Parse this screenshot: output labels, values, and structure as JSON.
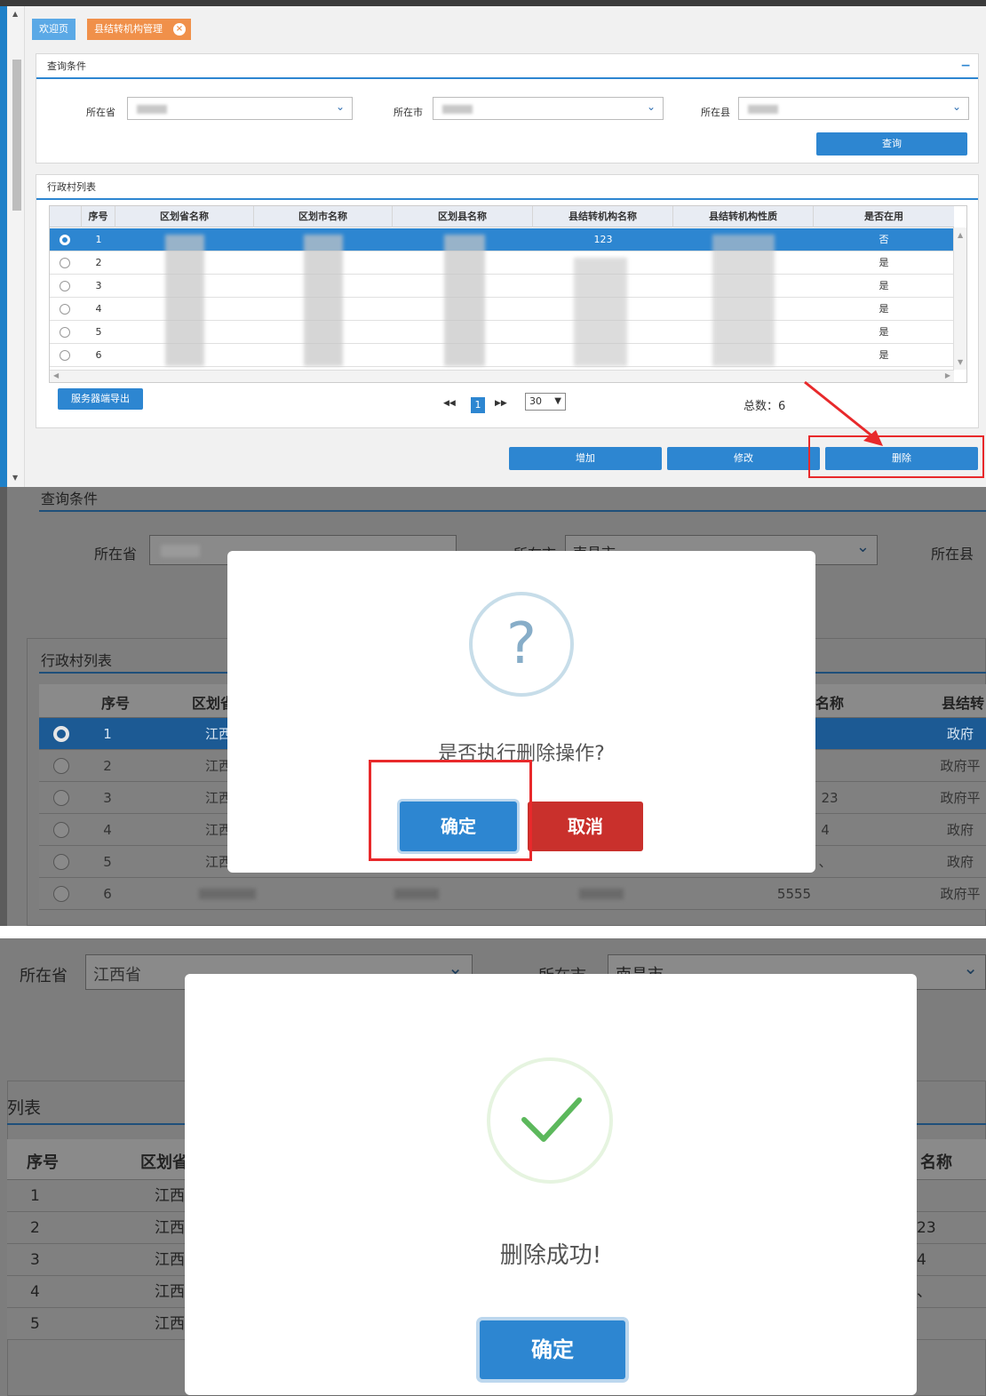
{
  "tabs": {
    "welcome": "欢迎页",
    "active": "县结转机构管理",
    "close_glyph": "×"
  },
  "query": {
    "title": "查询条件",
    "collapse_glyph": "−",
    "province_label": "所在省",
    "city_label": "所在市",
    "county_label": "所在县",
    "search_button": "查询"
  },
  "list": {
    "title": "行政村列表",
    "columns": [
      "序号",
      "区划省名称",
      "区划市名称",
      "区划县名称",
      "县结转机构名称",
      "县结转机构性质",
      "是否在用"
    ],
    "rows": [
      {
        "no": "1",
        "org_name": "123",
        "in_use": "否",
        "selected": true
      },
      {
        "no": "2",
        "org_name": "",
        "in_use": "是",
        "selected": false
      },
      {
        "no": "3",
        "org_name": "",
        "in_use": "是",
        "selected": false
      },
      {
        "no": "4",
        "org_name": "",
        "in_use": "是",
        "selected": false
      },
      {
        "no": "5",
        "org_name": "",
        "in_use": "是",
        "selected": false
      },
      {
        "no": "6",
        "org_name": "",
        "in_use": "是",
        "selected": false
      }
    ],
    "export_button": "服务器端导出",
    "pager": {
      "first": "◀◀",
      "page": "1",
      "last": "▶▶",
      "page_size": "30",
      "total": "总数：6"
    }
  },
  "actions": {
    "add": "增加",
    "edit": "修改",
    "delete": "删除"
  },
  "confirm_panel": {
    "query_title": "查询条件",
    "province_label": "所在省",
    "city_label": "所在市",
    "county_label": "所在县",
    "city_value": "南昌市",
    "list_title": "行政村列表",
    "col_no": "序号",
    "col_province": "区划省",
    "col_name": "名称",
    "col_nature": "县结转",
    "rows": [
      {
        "no": "1",
        "prov": "江西",
        "org": "",
        "nature": "政府"
      },
      {
        "no": "2",
        "prov": "江西",
        "org": "",
        "nature": "政府平"
      },
      {
        "no": "3",
        "prov": "江西",
        "org": "23",
        "nature": "政府平"
      },
      {
        "no": "4",
        "prov": "江西",
        "org": "4",
        "nature": "政府"
      },
      {
        "no": "5",
        "prov": "江西",
        "org": "、",
        "nature": "政府"
      },
      {
        "no": "6",
        "prov": "",
        "org": "5555",
        "nature": "政府平"
      }
    ],
    "dialog": {
      "icon_glyph": "?",
      "message": "是否执行删除操作?",
      "ok": "确定",
      "cancel": "取消"
    }
  },
  "success_panel": {
    "province_label": "所在省",
    "province_value": "江西省",
    "city_label": "所在市",
    "city_value": "南昌市",
    "list_title": "列表",
    "col_no": "序号",
    "col_province": "区划省",
    "col_name": "名称",
    "rows": [
      {
        "no": "1",
        "prov": "江西",
        "org": ""
      },
      {
        "no": "2",
        "prov": "江西",
        "org": "23"
      },
      {
        "no": "3",
        "prov": "江西",
        "org": "4"
      },
      {
        "no": "4",
        "prov": "江西",
        "org": "、"
      },
      {
        "no": "5",
        "prov": "江西",
        "org": ""
      }
    ],
    "dialog": {
      "message": "删除成功!",
      "ok": "确定"
    }
  },
  "colors": {
    "primary": "#2d86d1",
    "active_tab": "#f0904a",
    "danger": "#c9302c",
    "highlight": "#e8292b",
    "success": "#5cb85c"
  }
}
